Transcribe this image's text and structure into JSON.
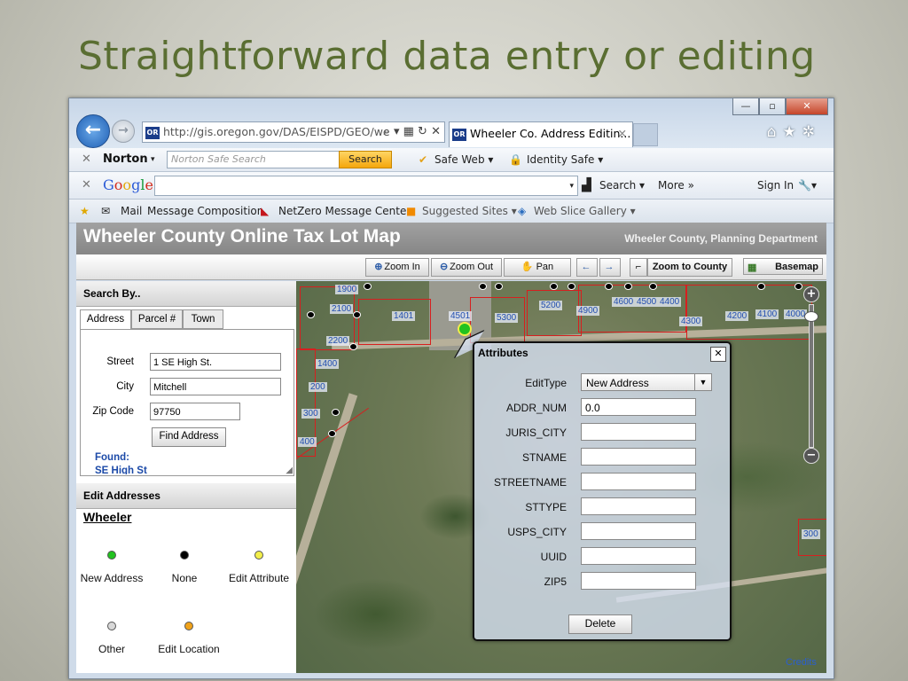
{
  "slide": {
    "title": "Straightforward data entry or editing"
  },
  "browser": {
    "address": "http://gis.oregon.gov/DAS/EISPD/GEO/we",
    "favicon_text": "OR",
    "tab_title": "Wheeler Co. Address Editin...",
    "window_buttons": {
      "minimize": "—",
      "maximize": "▫",
      "close": "✕"
    }
  },
  "norton": {
    "logo": "Norton",
    "placeholder": "Norton Safe Search",
    "search": "Search",
    "safe_web": "Safe Web ▾",
    "identity_safe": "Identity Safe ▾"
  },
  "google": {
    "logo_parts": [
      "G",
      "o",
      "o",
      "g",
      "l",
      "e"
    ],
    "search": "Search ▾",
    "more": "More »",
    "sign_in": "Sign In"
  },
  "favorites": {
    "mail": "Mail",
    "message_composition": "Message Composition",
    "netzero": "NetZero Message Center",
    "suggested": "Suggested Sites ▾",
    "web_slice": "Web Slice Gallery ▾"
  },
  "app": {
    "title": "Wheeler County Online Tax Lot Map",
    "subtitle": "Wheeler County, Planning Department"
  },
  "map_toolbar": {
    "zoom_in": "Zoom In",
    "zoom_out": "Zoom Out",
    "pan": "Pan",
    "zoom_county": "Zoom to County",
    "basemap": "Basemap"
  },
  "search_panel": {
    "header": "Search By..",
    "tabs": [
      "Address",
      "Parcel #",
      "Town"
    ],
    "fields": [
      {
        "label": "Street",
        "value": "1 SE High St."
      },
      {
        "label": "City",
        "value": "Mitchell"
      },
      {
        "label": "Zip Code",
        "value": "97750"
      }
    ],
    "find_button": "Find Address",
    "found_label": "Found:",
    "found_value": "SE High St"
  },
  "edit_panel": {
    "header": "Edit Addresses",
    "town": "Wheeler",
    "legend": [
      {
        "label": "New Address",
        "color": "#22c21f"
      },
      {
        "label": "None",
        "color": "#000000"
      },
      {
        "label": "Edit Attribute",
        "color": "#f2ee4a"
      },
      {
        "label": "Other",
        "color": "#d8d8d8"
      },
      {
        "label": "Edit Location",
        "color": "#f0a21a"
      }
    ]
  },
  "map": {
    "lot_labels": [
      "1900",
      "2100",
      "1401",
      "4501",
      "5300",
      "5200",
      "4900",
      "4600",
      "4500",
      "4400",
      "4200",
      "4100",
      "4000",
      "4300",
      "2200",
      "1400",
      "200",
      "300",
      "400",
      "300"
    ],
    "credits": "Credits"
  },
  "attributes": {
    "title": "Attributes",
    "close": "✕",
    "edit_type_label": "EditType",
    "edit_type_value": "New Address",
    "fields": [
      {
        "label": "ADDR_NUM",
        "value": "0.0"
      },
      {
        "label": "JURIS_CITY",
        "value": ""
      },
      {
        "label": "STNAME",
        "value": ""
      },
      {
        "label": "STREETNAME",
        "value": ""
      },
      {
        "label": "STTYPE",
        "value": ""
      },
      {
        "label": "USPS_CITY",
        "value": ""
      },
      {
        "label": "UUID",
        "value": ""
      },
      {
        "label": "ZIP5",
        "value": ""
      }
    ],
    "delete": "Delete"
  }
}
